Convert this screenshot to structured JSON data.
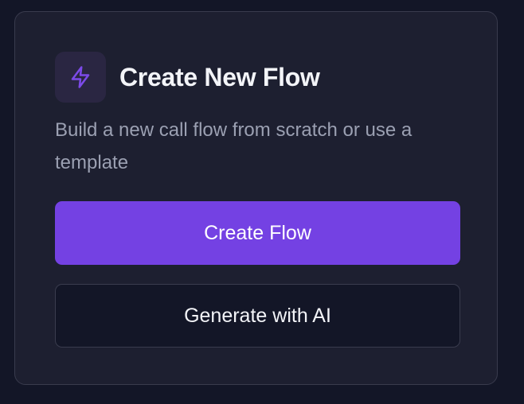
{
  "card": {
    "title": "Create New Flow",
    "description": "Build a new call flow from scratch or use a template",
    "icon": "lightning-bolt-icon"
  },
  "buttons": {
    "create_label": "Create Flow",
    "generate_label": "Generate with AI"
  },
  "colors": {
    "page_background": "#131627",
    "card_background": "#1d1f30",
    "accent": "#7441e3",
    "icon_color": "#7c4ae8",
    "title_text": "#f3f4f8",
    "muted_text": "#9ba0b2"
  }
}
